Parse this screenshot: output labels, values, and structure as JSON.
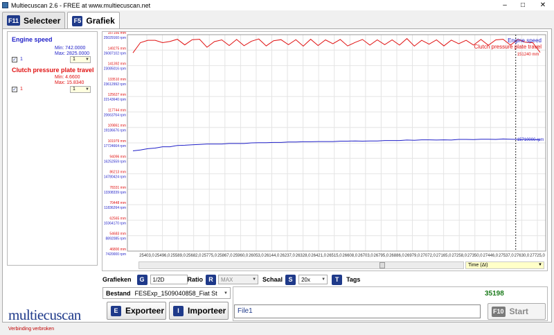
{
  "window": {
    "title": "Multiecuscan 2.6 - FREE at www.multiecuscan.net"
  },
  "tabs": [
    {
      "key": "F11",
      "label": "Selecteer"
    },
    {
      "key": "F5",
      "label": "Grafiek"
    }
  ],
  "signals": [
    {
      "name": "Engine speed",
      "color": "#1f1fc8",
      "min": "Min: 742.0000",
      "max": "Max: 2825.0000",
      "check_label": "1",
      "select_value": "1"
    },
    {
      "name": "Clutch pressure plate travel",
      "color": "#e01010",
      "min": "Min: 4.6600",
      "max": "Max: 15.8340",
      "check_label": "1",
      "select_value": "1"
    }
  ],
  "chart_data": {
    "type": "line",
    "xlabel": "",
    "ylabel": "",
    "x_ticks": [
      "25403,0",
      "25496,0",
      "25589,0",
      "25682,0",
      "25775,0",
      "25867,0",
      "25960,0",
      "26053,0",
      "26144,0",
      "26237,0",
      "26328,0",
      "26421,0",
      "26515,0",
      "26608,0",
      "26703,0",
      "26795,0",
      "26886,0",
      "26979,0",
      "27072,0",
      "27165,0",
      "27258,0",
      "27350,0",
      "27446,0",
      "27537,0",
      "27630,0",
      "27725,0"
    ],
    "y_ticks_red": [
      "157166 mm",
      "149275 mm",
      "141392 mm",
      "133510 mm",
      "125627 mm",
      "117744 mm",
      "109861 mm",
      "101979 mm",
      "94096 mm",
      "86213 mm",
      "78331 mm",
      "70448 mm",
      "62565 mm",
      "54683 mm",
      "46800 mm"
    ],
    "y_ticks_blue": [
      "25029160 rpm",
      "26087102 rpm",
      "23085016 rpm",
      "23612992 rpm",
      "22143640 rpm",
      "20663764 rpm",
      "19186676 rpm",
      "17724664 rpm",
      "16252559 rpm",
      "14780424 rpm",
      "13308339 rpm",
      "11836264 rpm",
      "10364170 rpm",
      "8892085 rpm",
      "7420000 rpm"
    ],
    "series": [
      {
        "name": "Engine speed",
        "color": "#1f1fc8",
        "values": [
          0.537,
          0.533,
          0.527,
          0.524,
          0.518,
          0.518,
          0.512,
          0.511,
          0.509,
          0.507,
          0.505,
          0.505,
          0.505,
          0.503,
          0.503,
          0.503,
          0.5,
          0.499,
          0.499,
          0.498,
          0.498,
          0.496,
          0.496,
          0.495,
          0.495,
          0.494,
          0.494,
          0.494,
          0.492,
          0.492,
          0.491,
          0.492,
          0.491,
          0.491,
          0.489,
          0.489,
          0.489,
          0.487,
          0.488,
          0.486,
          0.486,
          0.487,
          0.486,
          0.487,
          0.484,
          0.484,
          0.485,
          0.483,
          0.483,
          0.484,
          0.482,
          0.483,
          0.484,
          0.484,
          0.485,
          0.486
        ]
      },
      {
        "name": "Clutch pressure plate travel",
        "color": "#e01010",
        "values": [
          0.084,
          0.037,
          0.026,
          0.026,
          0.037,
          0.031,
          0.021,
          0.047,
          0.023,
          0.021,
          0.058,
          0.032,
          0.024,
          0.05,
          0.022,
          0.051,
          0.03,
          0.02,
          0.052,
          0.028,
          0.023,
          0.046,
          0.023,
          0.053,
          0.021,
          0.05,
          0.024,
          0.042,
          0.022,
          0.052,
          0.036,
          0.022,
          0.048,
          0.024,
          0.046,
          0.024,
          0.048,
          0.018,
          0.053,
          0.026,
          0.044,
          0.024,
          0.052,
          0.025,
          0.042,
          0.026,
          0.048,
          0.022,
          0.049,
          0.024,
          0.021,
          0.048,
          0.022,
          0.035,
          0.037,
          0.082
        ]
      }
    ],
    "legend": [
      "Engine speed",
      "Clutch pressure plate travel"
    ],
    "cursor_values": {
      "rpm": "15710000 rpm",
      "mm": "151240 mm"
    }
  },
  "scroll": {
    "time_label": "Time (Δt)"
  },
  "controls": {
    "grafieken_label": "Grafieken",
    "grafieken_key": "G",
    "grafieken_value": "1/2D",
    "ratio_label": "Ratio",
    "ratio_key": "R",
    "ratio_value": "MAX",
    "schaal_label": "Schaal",
    "schaal_key": "S",
    "schaal_value": "20x",
    "tags_label": "Tags",
    "tags_key": "T"
  },
  "bestand": {
    "label": "Bestand",
    "value": "FESExp_1509040858_Fiat St"
  },
  "buttons": {
    "export_key": "E",
    "export_label": "Exporteer",
    "import_key": "I",
    "import_label": "Importeer",
    "start_key": "F10",
    "start_label": "Start"
  },
  "counter": "35198",
  "file_field": "File1",
  "logo": "multiecuscan",
  "status": "Verbinding verbroken"
}
